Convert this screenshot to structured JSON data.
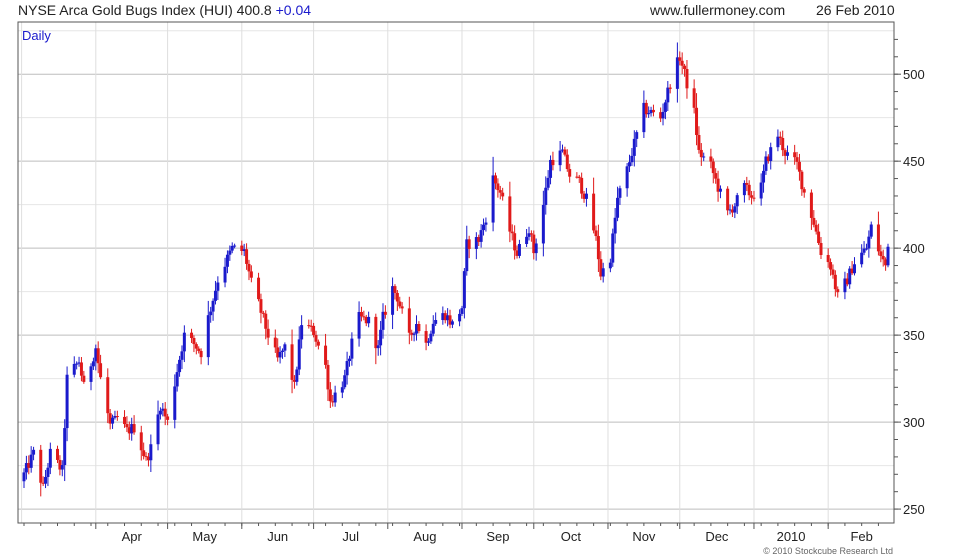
{
  "header": {
    "title": "NYSE Arca Gold Bugs Index (HUI)",
    "last": "400.8",
    "change": "+0.04",
    "site": "www.fullermoney.com",
    "date": "26 Feb 2010"
  },
  "period_label": "Daily",
  "copyright": "© 2010 Stockcube Research Ltd",
  "colors": {
    "up": "#1a1acc",
    "down": "#e01a1a",
    "grid": "#d6d6d6",
    "frame": "#555555"
  },
  "chart_data": {
    "type": "ohlc",
    "title": "NYSE Arca Gold Bugs Index (HUI)",
    "interval": "Daily",
    "ylim": [
      242,
      530
    ],
    "y_ticks": [
      250,
      300,
      350,
      400,
      450,
      500
    ],
    "x_tick_labels": [
      "Apr",
      "May",
      "Jun",
      "Jul",
      "Aug",
      "Sep",
      "Oct",
      "Nov",
      "Dec",
      "2010",
      "Feb"
    ],
    "x_range": [
      "2009-03-02",
      "2010-02-26"
    ],
    "grid": true,
    "close_path": [
      [
        "2009-03-02",
        270
      ],
      [
        "2009-03-06",
        282
      ],
      [
        "2009-03-10",
        262
      ],
      [
        "2009-03-13",
        282
      ],
      [
        "2009-03-18",
        272
      ],
      [
        "2009-03-20",
        325
      ],
      [
        "2009-03-25",
        335
      ],
      [
        "2009-03-27",
        320
      ],
      [
        "2009-04-01",
        343
      ],
      [
        "2009-04-03",
        325
      ],
      [
        "2009-04-07",
        298
      ],
      [
        "2009-04-10",
        302
      ],
      [
        "2009-04-14",
        295
      ],
      [
        "2009-04-17",
        297
      ],
      [
        "2009-04-22",
        278
      ],
      [
        "2009-04-24",
        285
      ],
      [
        "2009-04-28",
        310
      ],
      [
        "2009-05-01",
        300
      ],
      [
        "2009-05-05",
        330
      ],
      [
        "2009-05-08",
        350
      ],
      [
        "2009-05-12",
        345
      ],
      [
        "2009-05-15",
        340
      ],
      [
        "2009-05-18",
        360
      ],
      [
        "2009-05-22",
        382
      ],
      [
        "2009-05-28",
        400
      ],
      [
        "2009-06-02",
        398
      ],
      [
        "2009-06-05",
        380
      ],
      [
        "2009-06-08",
        368
      ],
      [
        "2009-06-12",
        350
      ],
      [
        "2009-06-16",
        336
      ],
      [
        "2009-06-19",
        343
      ],
      [
        "2009-06-23",
        320
      ],
      [
        "2009-06-26",
        357
      ],
      [
        "2009-07-01",
        352
      ],
      [
        "2009-07-06",
        332
      ],
      [
        "2009-07-08",
        312
      ],
      [
        "2009-07-10",
        316
      ],
      [
        "2009-07-14",
        325
      ],
      [
        "2009-07-17",
        345
      ],
      [
        "2009-07-20",
        360
      ],
      [
        "2009-07-24",
        358
      ],
      [
        "2009-07-28",
        342
      ],
      [
        "2009-07-30",
        360
      ],
      [
        "2009-08-03",
        377
      ],
      [
        "2009-08-05",
        372
      ],
      [
        "2009-08-10",
        348
      ],
      [
        "2009-08-13",
        357
      ],
      [
        "2009-08-17",
        345
      ],
      [
        "2009-08-20",
        358
      ],
      [
        "2009-08-25",
        362
      ],
      [
        "2009-08-28",
        356
      ],
      [
        "2009-09-01",
        366
      ],
      [
        "2009-09-03",
        402
      ],
      [
        "2009-09-08",
        405
      ],
      [
        "2009-09-11",
        418
      ],
      [
        "2009-09-14",
        440
      ],
      [
        "2009-09-17",
        432
      ],
      [
        "2009-09-21",
        410
      ],
      [
        "2009-09-24",
        397
      ],
      [
        "2009-09-29",
        412
      ],
      [
        "2009-10-01",
        398
      ],
      [
        "2009-10-05",
        425
      ],
      [
        "2009-10-08",
        450
      ],
      [
        "2009-10-13",
        455
      ],
      [
        "2009-10-16",
        442
      ],
      [
        "2009-10-20",
        438
      ],
      [
        "2009-10-23",
        428
      ],
      [
        "2009-10-27",
        405
      ],
      [
        "2009-10-29",
        385
      ],
      [
        "2009-11-02",
        395
      ],
      [
        "2009-11-05",
        428
      ],
      [
        "2009-11-09",
        445
      ],
      [
        "2009-11-12",
        460
      ],
      [
        "2009-11-16",
        480
      ],
      [
        "2009-11-19",
        478
      ],
      [
        "2009-11-23",
        475
      ],
      [
        "2009-11-27",
        495
      ],
      [
        "2009-12-01",
        510
      ],
      [
        "2009-12-03",
        500
      ],
      [
        "2009-12-07",
        478
      ],
      [
        "2009-12-09",
        455
      ],
      [
        "2009-12-14",
        447
      ],
      [
        "2009-12-17",
        435
      ],
      [
        "2009-12-21",
        420
      ],
      [
        "2009-12-24",
        425
      ],
      [
        "2009-12-28",
        435
      ],
      [
        "2009-12-31",
        430
      ],
      [
        "2010-01-04",
        435
      ],
      [
        "2010-01-06",
        450
      ],
      [
        "2010-01-11",
        465
      ],
      [
        "2010-01-14",
        455
      ],
      [
        "2010-01-19",
        448
      ],
      [
        "2010-01-22",
        432
      ],
      [
        "2010-01-26",
        415
      ],
      [
        "2010-01-29",
        398
      ],
      [
        "2010-02-02",
        390
      ],
      [
        "2010-02-05",
        372
      ],
      [
        "2010-02-09",
        382
      ],
      [
        "2010-02-12",
        392
      ],
      [
        "2010-02-17",
        400
      ],
      [
        "2010-02-19",
        412
      ],
      [
        "2010-02-23",
        395
      ],
      [
        "2010-02-25",
        390
      ],
      [
        "2010-02-26",
        400.8
      ]
    ]
  }
}
